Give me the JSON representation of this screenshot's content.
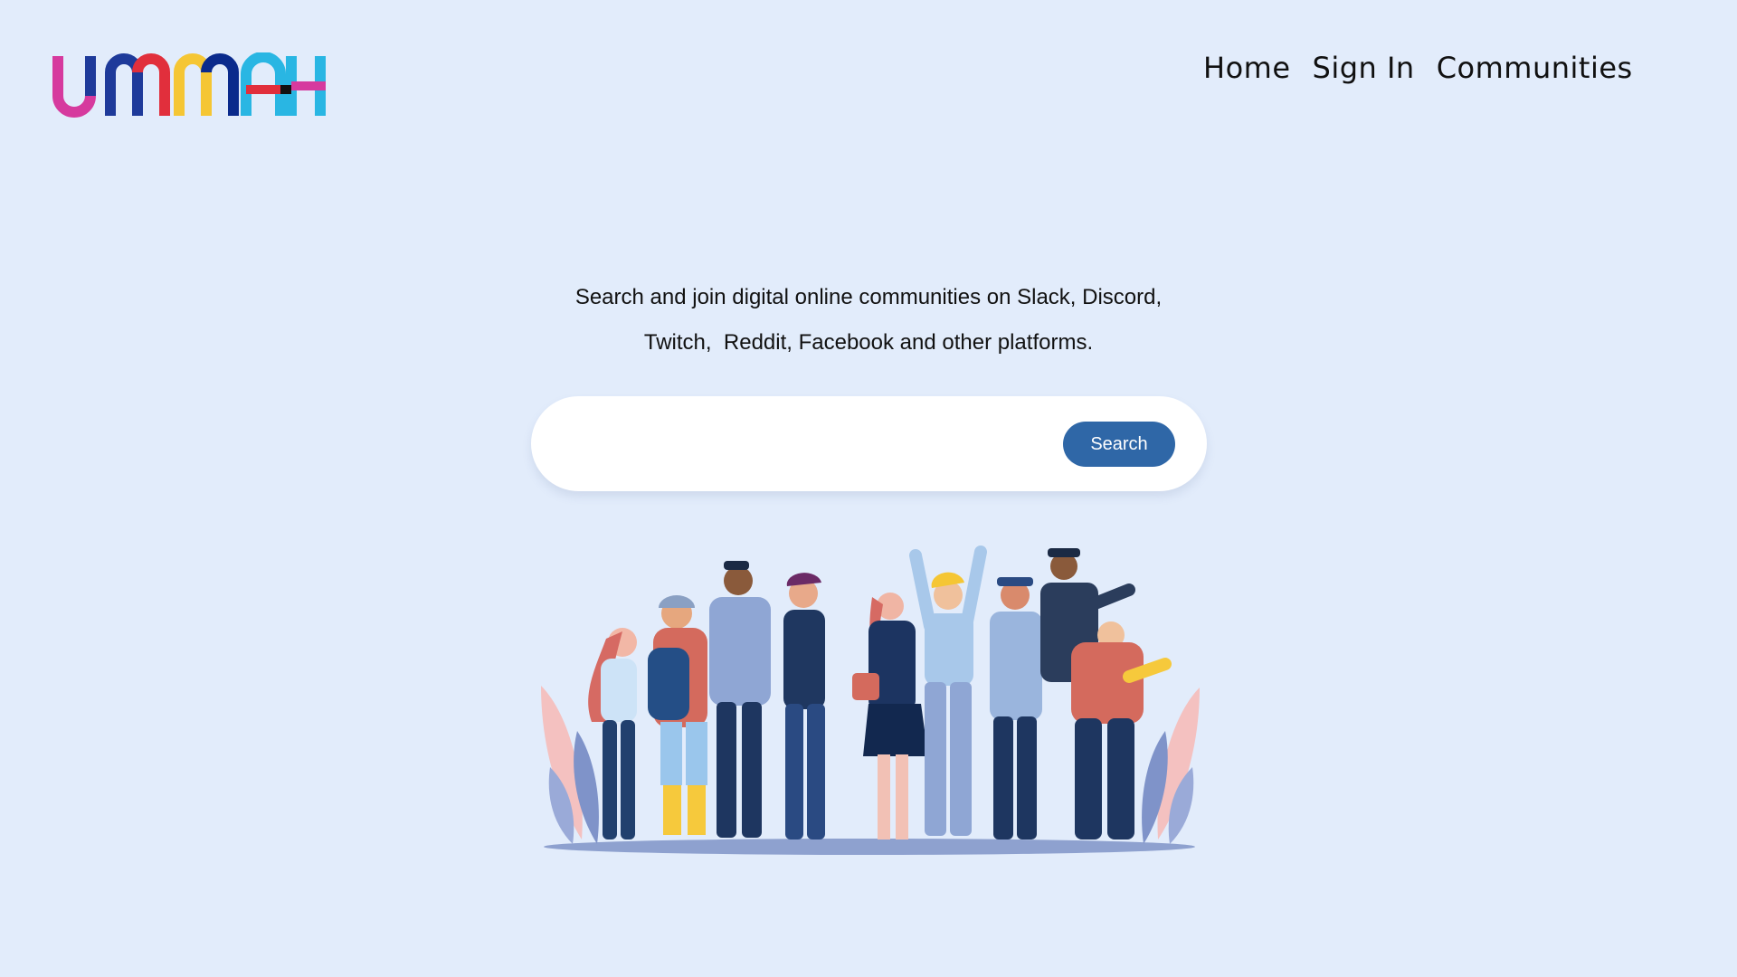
{
  "brand": {
    "logo_text": "UMMAH",
    "colors": [
      "#d63a9e",
      "#1e3a9a",
      "#e12f3c",
      "#f5c634",
      "#0a2a8c",
      "#29b6e3"
    ]
  },
  "nav": {
    "items": [
      {
        "label": "Home"
      },
      {
        "label": "Sign In"
      },
      {
        "label": "Communities"
      }
    ]
  },
  "hero": {
    "line1": "Search and join digital online communities on Slack, Discord,",
    "line2": "Twitch,  Reddit, Facebook and other platforms."
  },
  "search": {
    "placeholder": "",
    "value": "",
    "button_label": "Search",
    "button_color": "#2f67a7"
  },
  "illustration": {
    "icon": "group-of-people-illustration"
  },
  "theme": {
    "background": "#e2ecfb"
  }
}
